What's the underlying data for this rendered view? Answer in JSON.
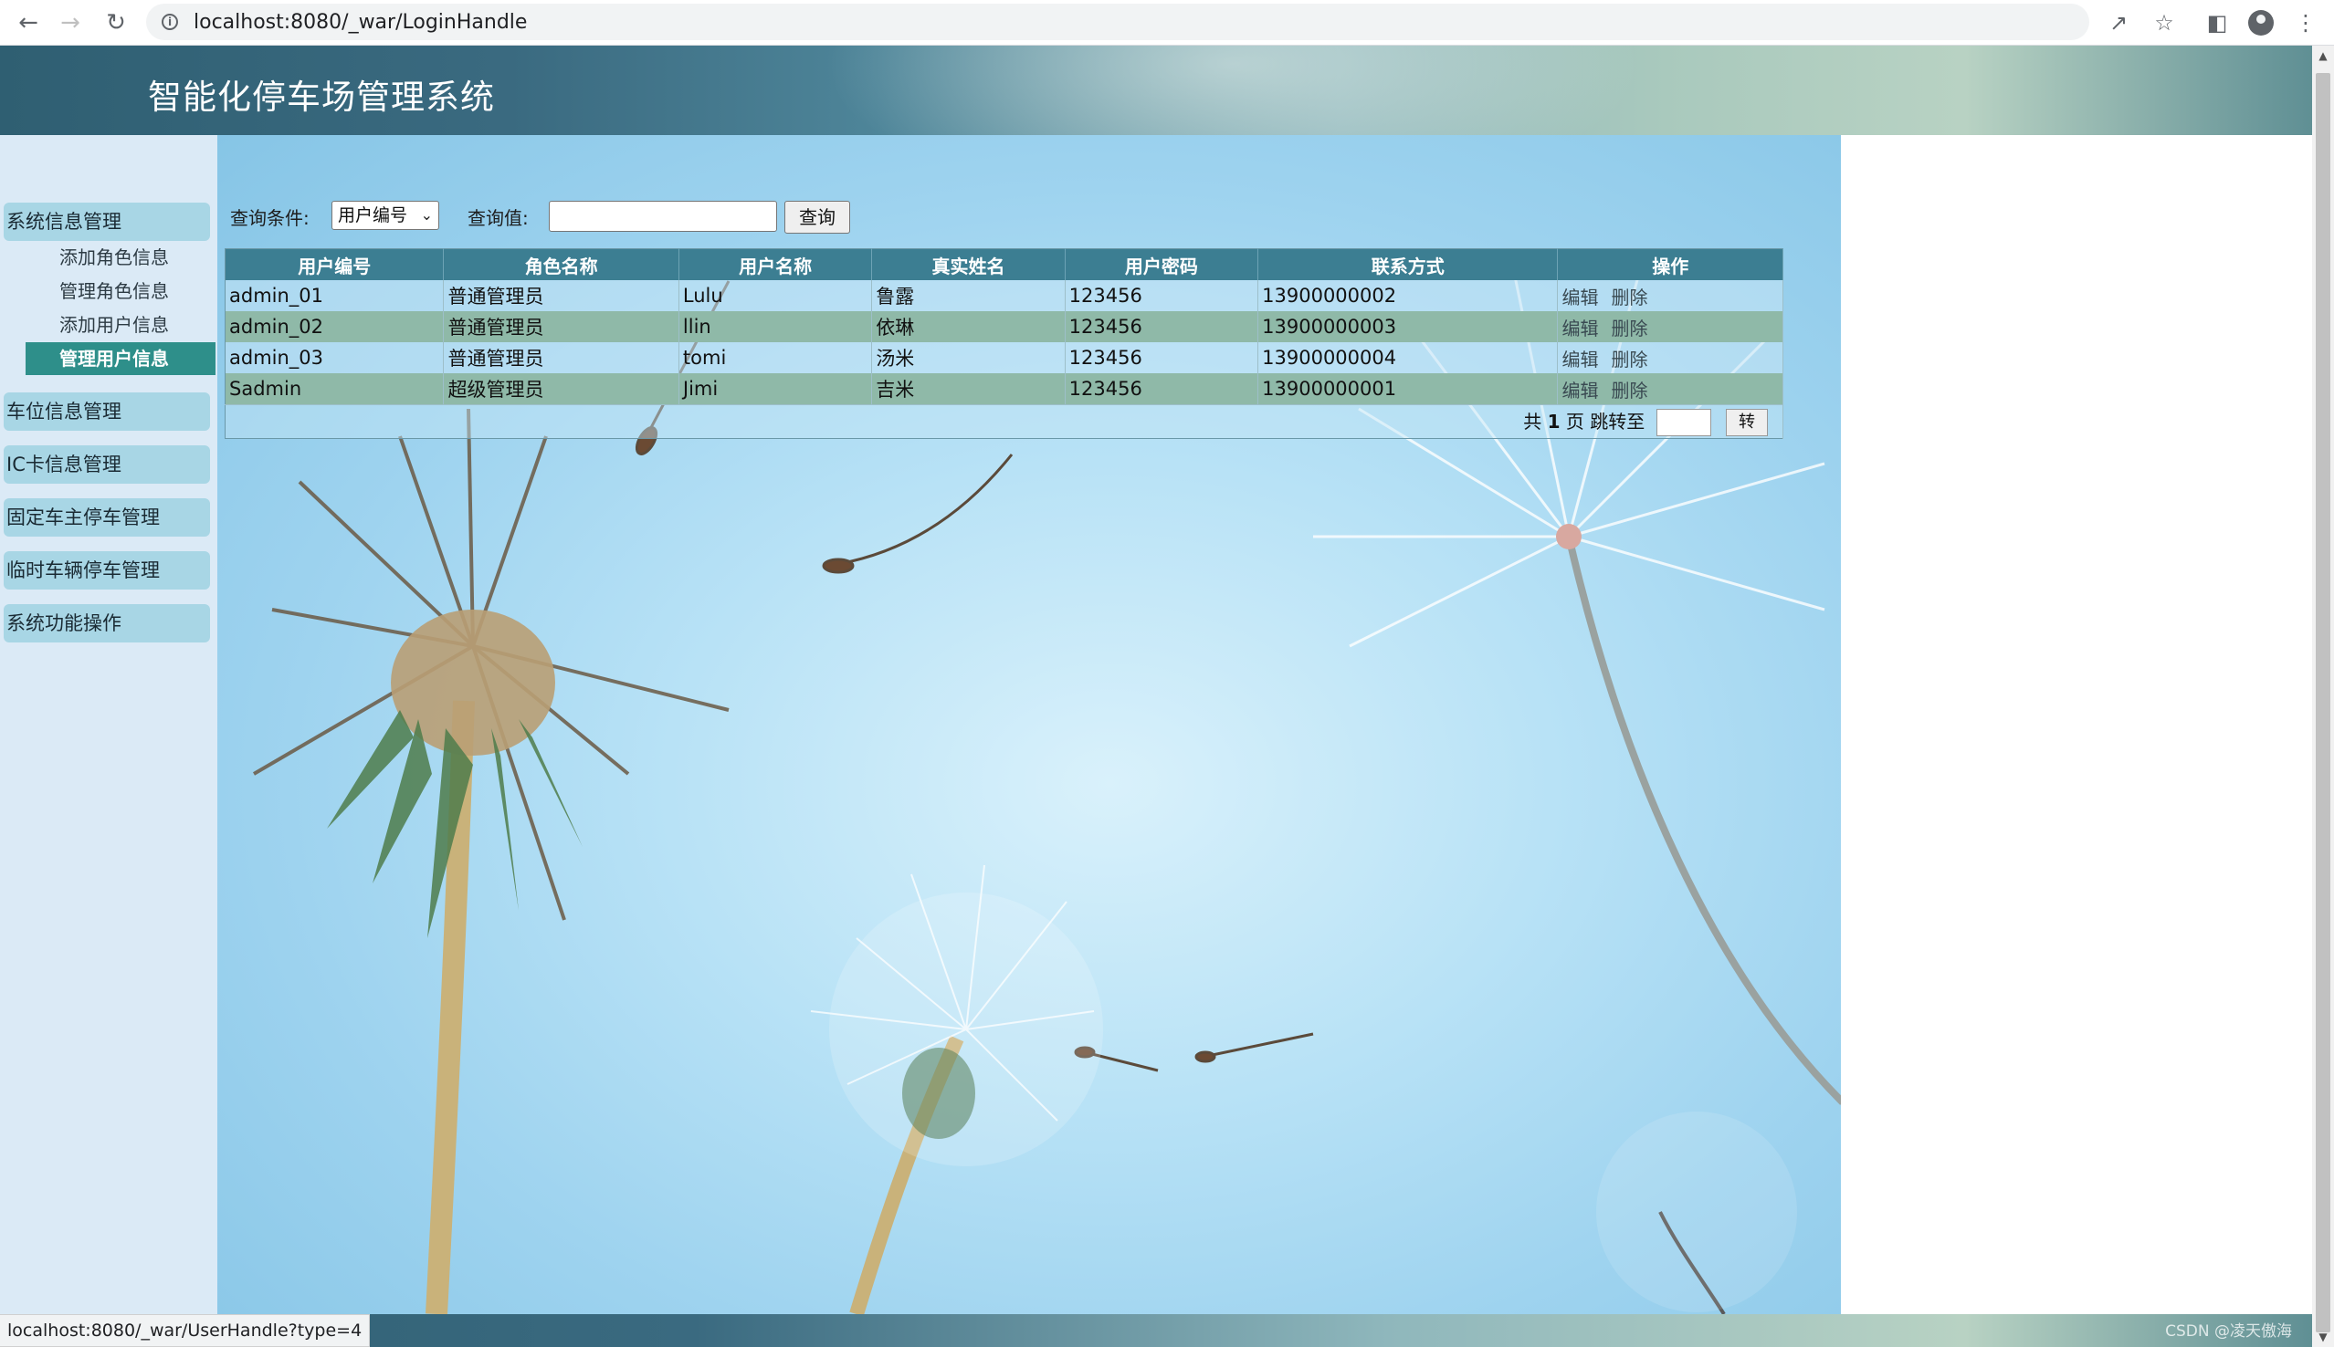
{
  "browser": {
    "url": "localhost:8080/_war/LoginHandle",
    "status_url": "localhost:8080/_war/UserHandle?type=4",
    "icons": [
      "back-icon",
      "forward-icon",
      "reload-icon",
      "info-icon",
      "share-icon",
      "star-icon",
      "sidepanel-icon",
      "profile-icon",
      "menu-icon"
    ]
  },
  "header": {
    "title": "智能化停车场管理系统"
  },
  "sidebar": {
    "groups": [
      {
        "label": "系统信息管理"
      },
      {
        "label": "车位信息管理"
      },
      {
        "label": "IC卡信息管理"
      },
      {
        "label": "固定车主停车管理"
      },
      {
        "label": "临时车辆停车管理"
      },
      {
        "label": "系统功能操作"
      }
    ],
    "sub_items": [
      {
        "label": "添加角色信息"
      },
      {
        "label": "管理角色信息"
      },
      {
        "label": "添加用户信息"
      },
      {
        "label": "管理用户信息",
        "active": true
      }
    ]
  },
  "query": {
    "condition_label": "查询条件:",
    "condition_value": "用户编号",
    "value_label": "查询值:",
    "value_input": "",
    "button_label": "查询"
  },
  "table": {
    "headers": [
      "用户编号",
      "角色名称",
      "用户名称",
      "真实姓名",
      "用户密码",
      "联系方式",
      "操作"
    ],
    "rows": [
      {
        "user_id": "admin_01",
        "role": "普通管理员",
        "username": "Lulu",
        "real_name": "鲁露",
        "password": "123456",
        "contact": "13900000002",
        "edit": "编辑",
        "delete": "删除"
      },
      {
        "user_id": "admin_02",
        "role": "普通管理员",
        "username": "llin",
        "real_name": "依琳",
        "password": "123456",
        "contact": "13900000003",
        "edit": "编辑",
        "delete": "删除"
      },
      {
        "user_id": "admin_03",
        "role": "普通管理员",
        "username": "tomi",
        "real_name": "汤米",
        "password": "123456",
        "contact": "13900000004",
        "edit": "编辑",
        "delete": "删除"
      },
      {
        "user_id": "Sadmin",
        "role": "超级管理员",
        "username": "Jimi",
        "real_name": "吉米",
        "password": "123456",
        "contact": "13900000001",
        "edit": "编辑",
        "delete": "删除"
      }
    ]
  },
  "pager": {
    "prefix": "共",
    "total_pages": "1",
    "suffix": "页 跳转至",
    "jump_value": "",
    "go_label": "转"
  },
  "watermark": "CSDN @凌天傲海",
  "colors": {
    "header_bar": "#3c7e92",
    "active_menu": "#2e8f8a",
    "menu_group": "#a8d6e5",
    "sidebar_bg": "#dbeaf6",
    "row_even": "#8fb9a8"
  }
}
